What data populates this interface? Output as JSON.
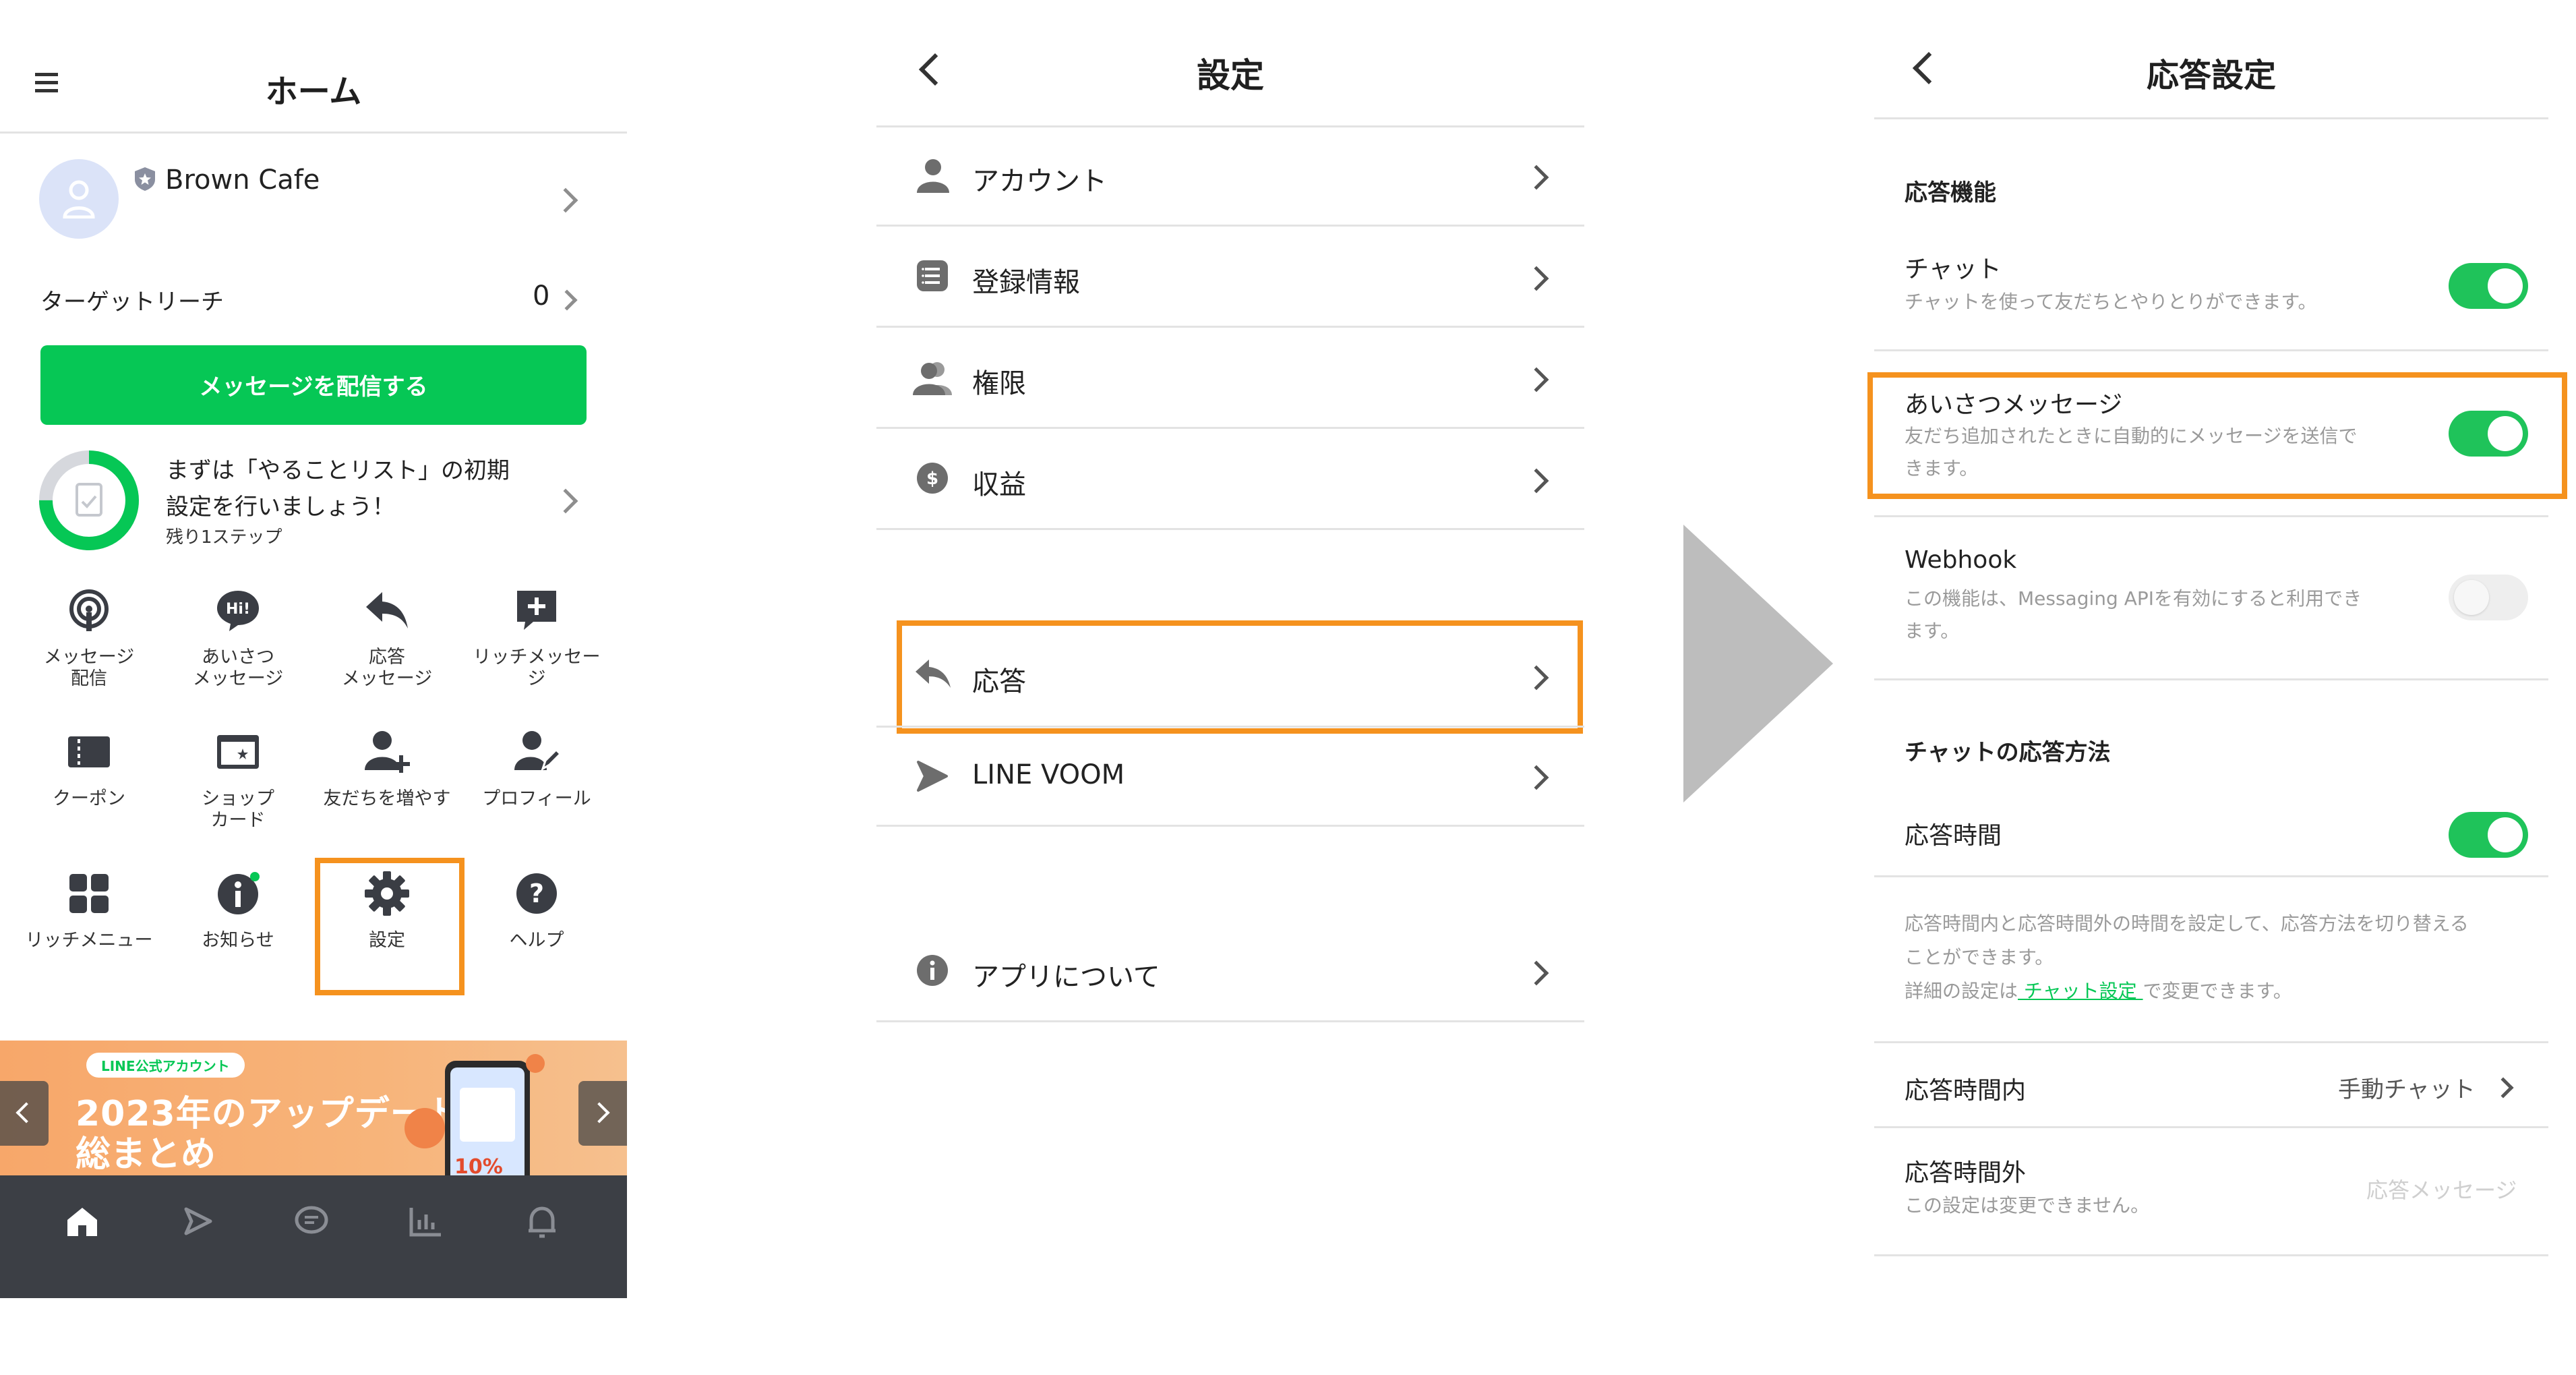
{
  "panel1": {
    "title": "ホーム",
    "account_name": "Brown Cafe",
    "target_reach_label": "ターゲットリーチ",
    "target_reach_value": "0",
    "broadcast_button": "メッセージを配信する",
    "todo_line1": "まずは「やることリスト」の初期",
    "todo_line2": "設定を行いましょう！",
    "todo_remaining": "残り1ステップ",
    "todo_progress": 0.75,
    "grid": [
      {
        "icon": "broadcast-icon",
        "line1": "メッセージ",
        "line2": "配信"
      },
      {
        "icon": "greeting-icon",
        "line1": "あいさつ",
        "line2": "メッセージ"
      },
      {
        "icon": "reply-icon",
        "line1": "応答",
        "line2": "メッセージ"
      },
      {
        "icon": "rich-message-icon",
        "line1": "リッチメッセー",
        "line2": "ジ"
      },
      {
        "icon": "coupon-icon",
        "line1": "クーポン",
        "line2": ""
      },
      {
        "icon": "shop-card-icon",
        "line1": "ショップ",
        "line2": "カード"
      },
      {
        "icon": "add-friends-icon",
        "line1": "友だちを増やす",
        "line2": ""
      },
      {
        "icon": "profile-icon",
        "line1": "プロフィール",
        "line2": ""
      },
      {
        "icon": "rich-menu-icon",
        "line1": "リッチメニュー",
        "line2": ""
      },
      {
        "icon": "info-icon",
        "line1": "お知らせ",
        "line2": ""
      },
      {
        "icon": "settings-gear-icon",
        "line1": "設定",
        "line2": ""
      },
      {
        "icon": "help-icon",
        "line1": "ヘルプ",
        "line2": ""
      }
    ],
    "banner": {
      "tag": "LINE公式アカウント",
      "line1": "2023年のアップデート",
      "line2": "総まとめ",
      "badge": "10%"
    },
    "bottom_nav": [
      "home-icon",
      "voom-icon",
      "chat-icon",
      "insight-icon",
      "notification-icon"
    ]
  },
  "panel2": {
    "title": "設定",
    "items": [
      {
        "icon": "account-icon",
        "label": "アカウント"
      },
      {
        "icon": "registration-info-icon",
        "label": "登録情報"
      },
      {
        "icon": "permissions-icon",
        "label": "権限"
      },
      {
        "icon": "revenue-icon",
        "label": "収益"
      },
      {
        "icon": "reply-icon",
        "label": "応答"
      },
      {
        "icon": "line-voom-icon",
        "label": "LINE VOOM"
      },
      {
        "icon": "about-icon",
        "label": "アプリについて"
      }
    ]
  },
  "panel3": {
    "title": "応答設定",
    "section1": "応答機能",
    "chat_label": "チャット",
    "chat_desc": "チャットを使って友だちとやりとりができます。",
    "chat_on": true,
    "greeting_label": "あいさつメッセージ",
    "greeting_desc1": "友だち追加されたときに自動的にメッセージを送信で",
    "greeting_desc2": "きます。",
    "greeting_on": true,
    "webhook_label": "Webhook",
    "webhook_desc1": "この機能は、Messaging APIを有効にすると利用でき",
    "webhook_desc2": "ます。",
    "webhook_on": false,
    "section2": "チャットの応答方法",
    "hours_label": "応答時間",
    "hours_on": true,
    "hours_desc1": "応答時間内と応答時間外の時間を設定して、応答方法を切り替える",
    "hours_desc2": "ことができます。",
    "hours_desc3_pre": "詳細の設定は",
    "hours_desc3_link": " チャット設定 ",
    "hours_desc3_post": "で変更できます。",
    "in_hours_label": "応答時間内",
    "in_hours_value": "手動チャット",
    "out_hours_label": "応答時間外",
    "out_hours_desc": "この設定は変更できません。",
    "out_hours_value": "応答メッセージ"
  },
  "colors": {
    "line_green": "#06c755",
    "toggle_green": "#1fc35a",
    "highlight_orange": "#f5921e",
    "nav_dark": "#3c3f45",
    "arrow_gray": "#bdbdbd"
  }
}
